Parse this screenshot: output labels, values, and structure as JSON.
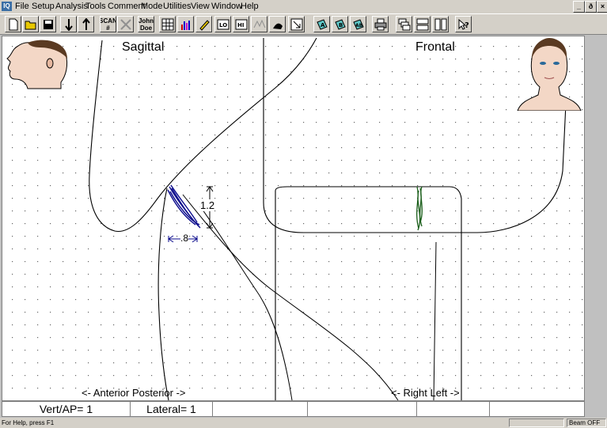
{
  "app_icon_text": "IQ",
  "menu": [
    "File",
    "Setup",
    "Analysis",
    "Tools",
    "Comment",
    "Mode",
    "Utilities",
    "View",
    "Window",
    "Help"
  ],
  "window_controls": [
    "_",
    "ð",
    "×"
  ],
  "toolbar": {
    "scan_label": "SCAN\n#",
    "name_label": "John\nDoe"
  },
  "plot": {
    "sagittal_title": "Sagittal",
    "frontal_title": "Frontal",
    "vertical_measure": "1.2",
    "horizontal_measure": ".8",
    "sagittal_axis": "<- Anterior  Posterior ->",
    "frontal_axis": "<- Right  Left ->",
    "colors": {
      "sagittal": "#0a0a8c",
      "frontal": "#1a5e1a",
      "trace": "#000000"
    }
  },
  "scale_row": {
    "vert_ap": "Vert/AP= 1",
    "lateral": "Lateral= 1"
  },
  "statusbar": {
    "help_text": "For Help, press F1",
    "beam_status": "Beam OFF"
  }
}
